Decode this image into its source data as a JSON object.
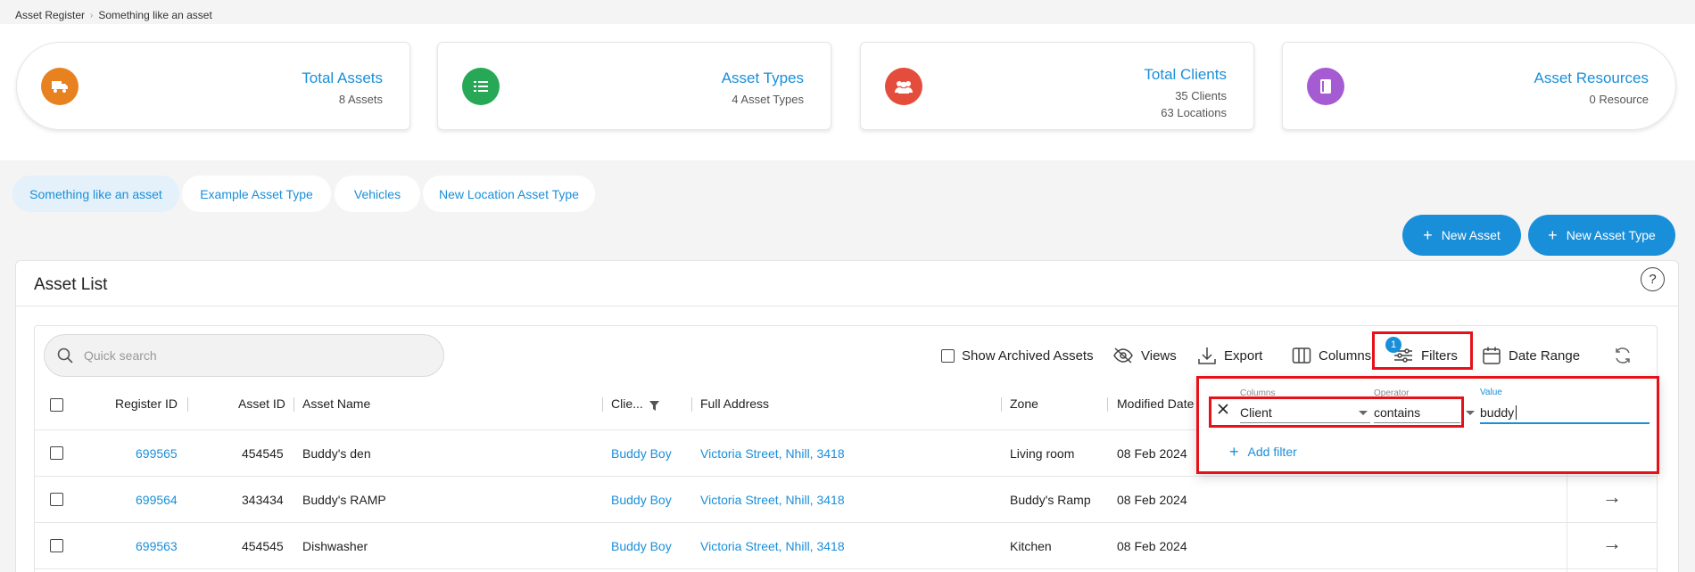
{
  "breadcrumb": [
    "Asset Register",
    "Something like an asset"
  ],
  "stats": [
    {
      "title": "Total Assets",
      "sub": "8 Assets",
      "sub2": "",
      "color": "#e8811f",
      "icon": "truck-icon"
    },
    {
      "title": "Asset Types",
      "sub": "4 Asset Types",
      "sub2": "",
      "color": "#27a856",
      "icon": "list-icon"
    },
    {
      "title": "Total Clients",
      "sub": "35 Clients",
      "sub2": "63 Locations",
      "color": "#e44d3b",
      "icon": "users-icon"
    },
    {
      "title": "Asset Resources",
      "sub": "0 Resource",
      "sub2": "",
      "color": "#a55bd1",
      "icon": "book-icon"
    }
  ],
  "type_tabs": [
    "Something like an asset",
    "Example Asset Type",
    "Vehicles",
    "New Location Asset Type"
  ],
  "actions": {
    "new_asset": "New Asset",
    "new_asset_type": "New Asset Type"
  },
  "panel": {
    "title": "Asset List",
    "help": "?"
  },
  "toolbar": {
    "search_placeholder": "Quick search",
    "show_archived": "Show Archived Assets",
    "views": "Views",
    "export": "Export",
    "columns": "Columns",
    "filters": "Filters",
    "filters_count": "1",
    "date_range": "Date Range"
  },
  "table": {
    "headers": {
      "register_id": "Register ID",
      "asset_id": "Asset ID",
      "asset_name": "Asset Name",
      "client": "Clie...",
      "full_address": "Full Address",
      "zone": "Zone",
      "modified_date": "Modified Date"
    },
    "rows": [
      {
        "register_id": "699565",
        "asset_id": "454545",
        "asset_name": "Buddy's den",
        "client": "Buddy Boy",
        "address": "Victoria Street, Nhill, 3418",
        "zone": "Living room",
        "modified": "08 Feb 2024"
      },
      {
        "register_id": "699564",
        "asset_id": "343434",
        "asset_name": "Buddy's RAMP",
        "client": "Buddy Boy",
        "address": "Victoria Street, Nhill, 3418",
        "zone": "Buddy's Ramp",
        "modified": "08 Feb 2024"
      },
      {
        "register_id": "699563",
        "asset_id": "454545",
        "asset_name": "Dishwasher",
        "client": "Buddy Boy",
        "address": "Victoria Street, Nhill, 3418",
        "zone": "Kitchen",
        "modified": "08 Feb 2024"
      }
    ]
  },
  "filter": {
    "columns_label": "Columns",
    "operator_label": "Operator",
    "value_label": "Value",
    "column": "Client",
    "operator": "contains",
    "value": "buddy",
    "add_filter": "Add filter"
  }
}
